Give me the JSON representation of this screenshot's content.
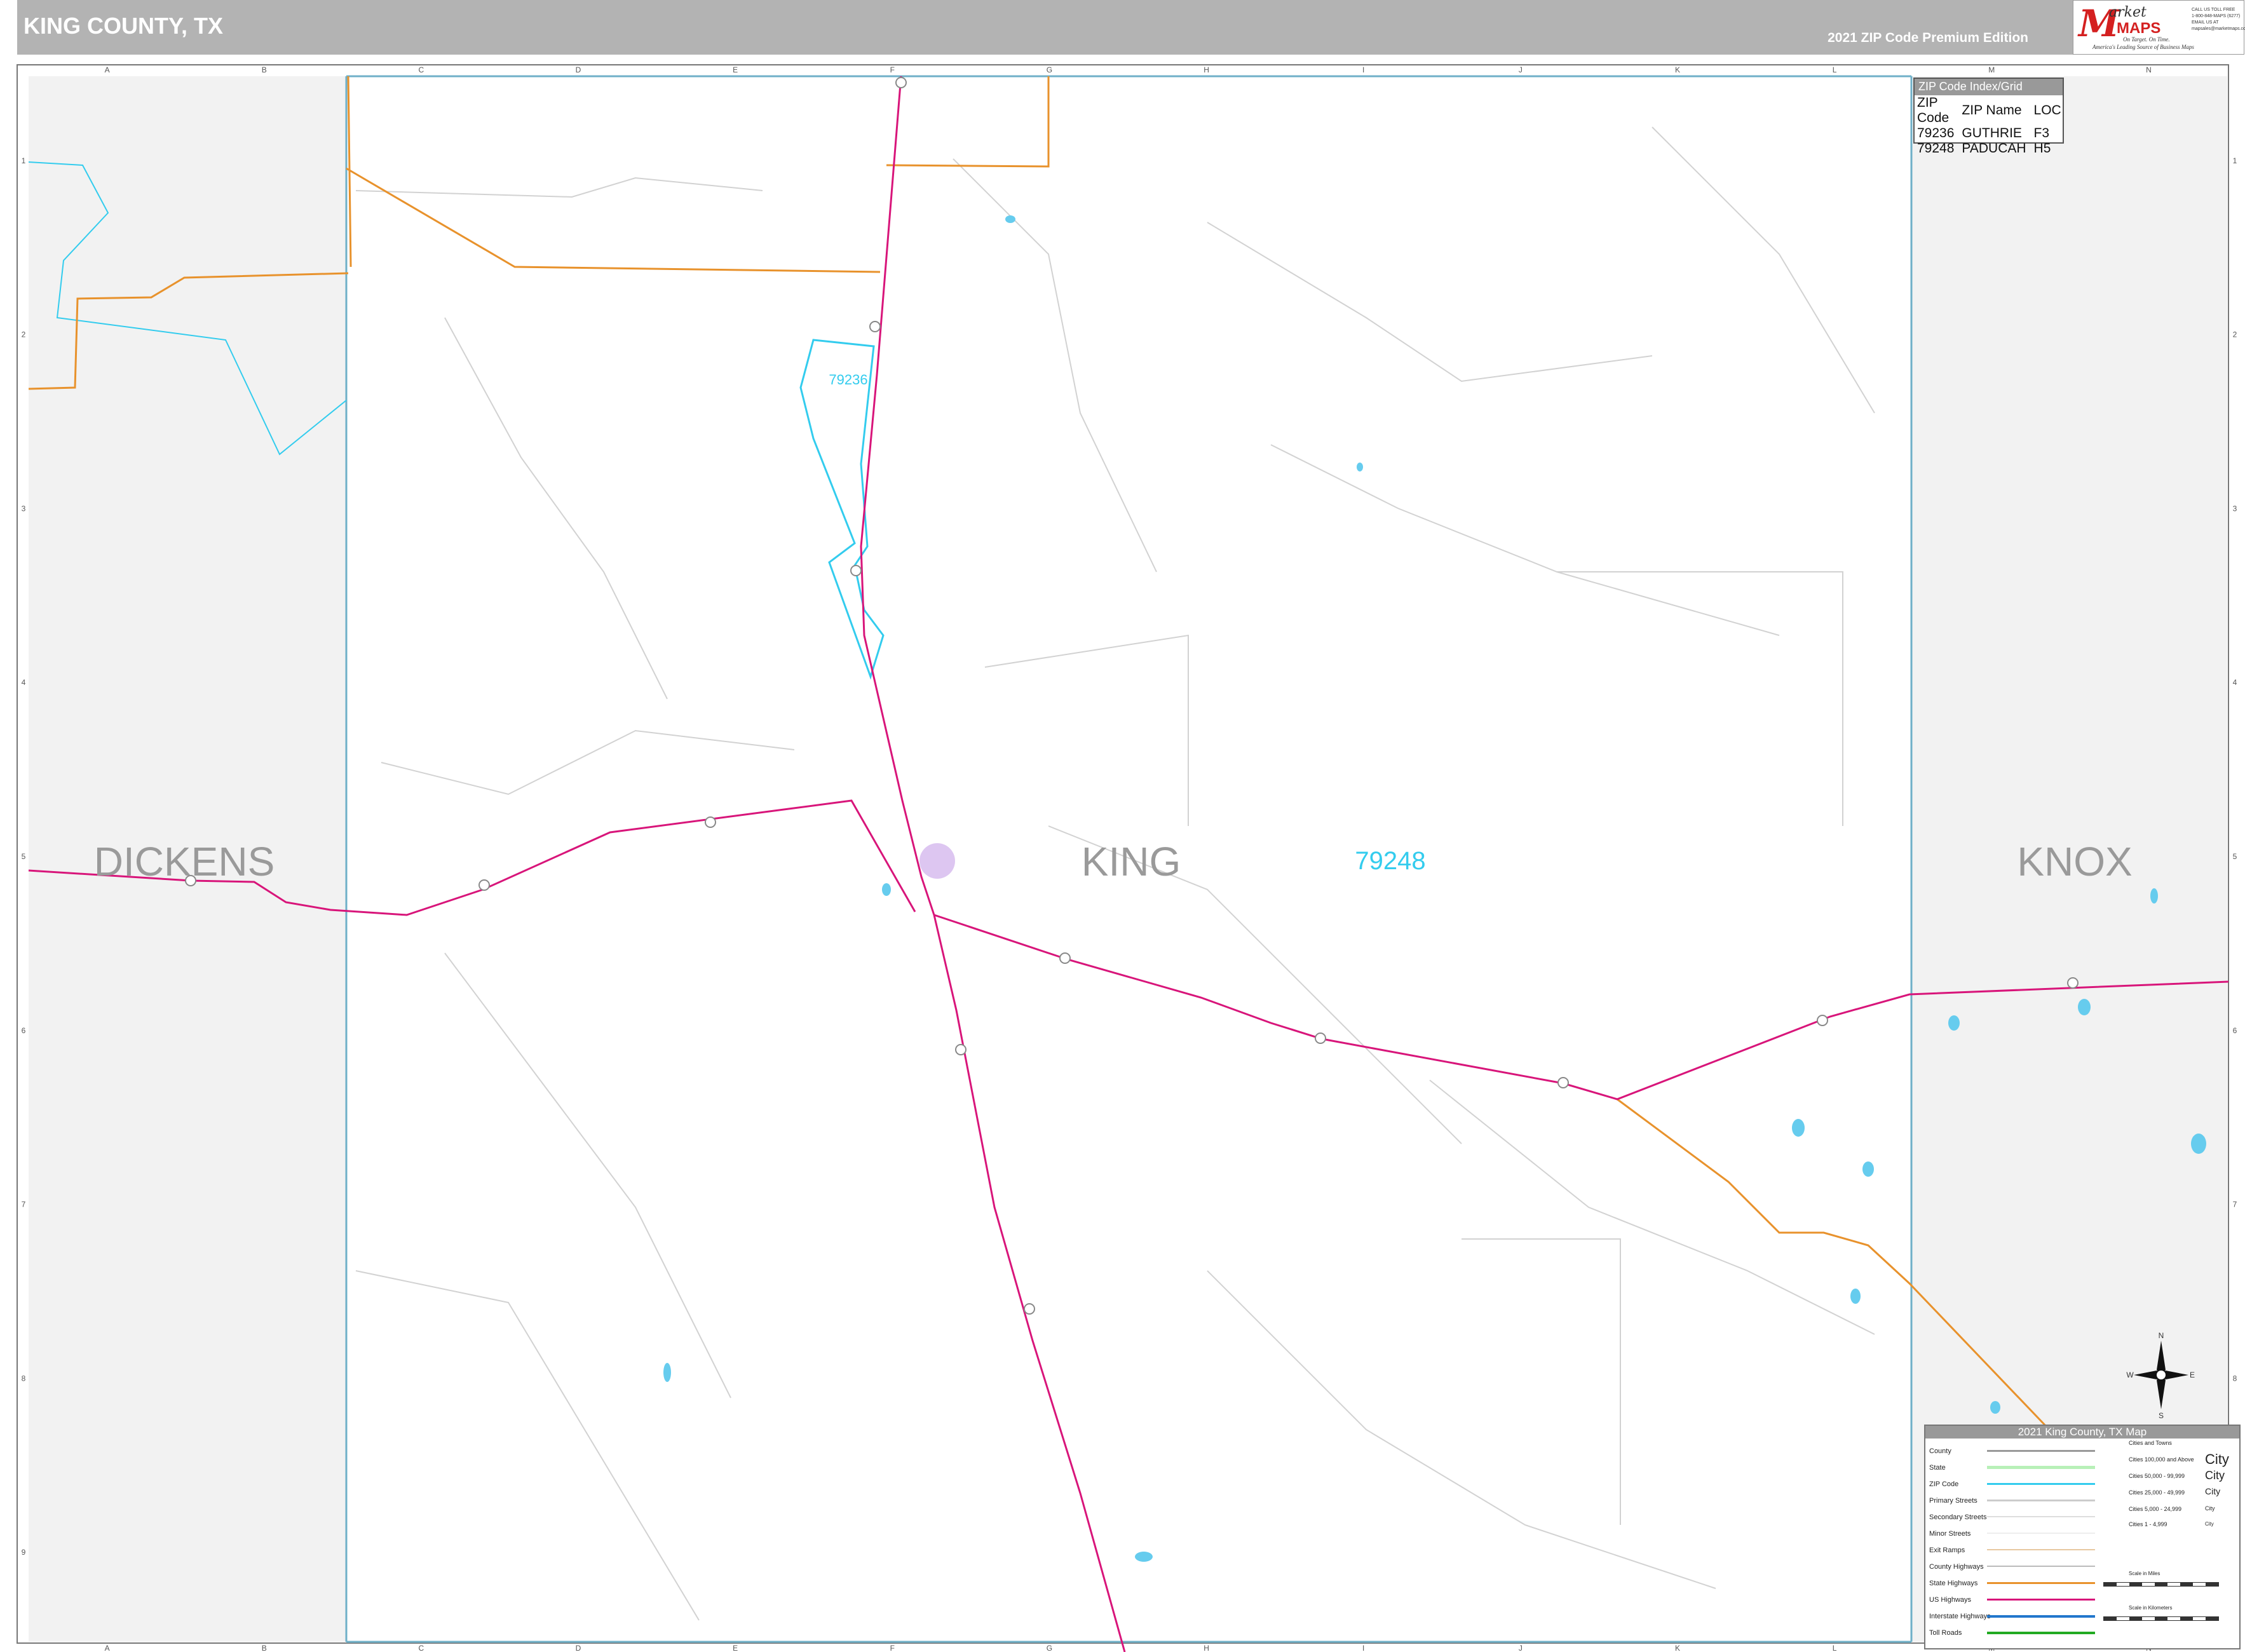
{
  "header": {
    "title": "KING COUNTY, TX",
    "edition": "2021 ZIP Code Premium Edition"
  },
  "logo": {
    "m": "M",
    "arket": "arket",
    "maps": "MAPS",
    "tagline_1": "On Target.  On Time.",
    "tagline_2": "America's Leading Source of Business Maps",
    "contact_1": "CALL US TOLL FREE",
    "contact_2": "1-800-848-MAPS (6277)",
    "contact_3": "EMAIL US AT",
    "contact_4": "mapsales@marketmaps.com"
  },
  "grid": {
    "columns": [
      "A",
      "B",
      "C",
      "D",
      "E",
      "F",
      "G",
      "H",
      "I",
      "J",
      "K",
      "L",
      "M",
      "N"
    ],
    "rows": [
      "1",
      "2",
      "3",
      "4",
      "5",
      "6",
      "7",
      "8",
      "9"
    ]
  },
  "map_labels": {
    "county_west": "DICKENS",
    "county_center": "KING",
    "county_east": "KNOX",
    "zip_main": "79248",
    "zip_north": "79236"
  },
  "colors": {
    "us_highway": "#d8157a",
    "state_highway": "#e8922c",
    "zip_boundary": "#33ccee",
    "county_boundary": "#6fb0c8",
    "outside_county_fill": "#f2f2f2",
    "water": "#66ccee",
    "minor_streets": "#d2d2d2"
  },
  "zip_index": {
    "title": "ZIP Code Index/Grid Locator",
    "headers": [
      "ZIP Code",
      "ZIP Name",
      "LOC"
    ],
    "rows": [
      [
        "79236",
        "GUTHRIE",
        "F3"
      ],
      [
        "79248",
        "PADUCAH",
        "H5"
      ]
    ]
  },
  "legend": {
    "title": "2021 King County, TX Map",
    "items": [
      "County",
      "State",
      "ZIP Code",
      "Primary Streets",
      "Secondary Streets",
      "Minor Streets",
      "Exit Ramps",
      "County Highways",
      "State Highways",
      "US Highways",
      "Interstate Highways",
      "Toll Roads"
    ],
    "cities_header": "Cities and Towns",
    "city_classes": [
      "Cities 100,000 and Above",
      "Cities 50,000 - 99,999",
      "Cities 25,000 - 49,999",
      "Cities 5,000 - 24,999",
      "Cities 1 - 4,999"
    ],
    "city_samples": [
      "City",
      "City",
      "City",
      "City",
      "City"
    ],
    "scale_miles": "Scale in Miles",
    "scale_km": "Scale in Kilometers"
  },
  "compass": {
    "n": "N",
    "s": "S",
    "e": "E",
    "w": "W"
  }
}
